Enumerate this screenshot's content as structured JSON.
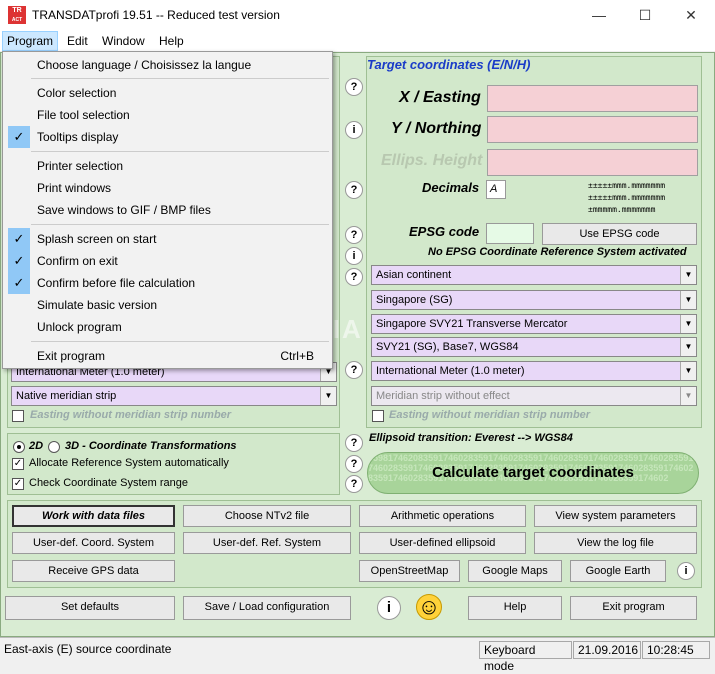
{
  "window": {
    "title": "TRANSDATprofi 19.51 -- Reduced test version",
    "logo_text": "ACT SOFT"
  },
  "window_controls": {
    "minimize": "—",
    "maximize": "☐",
    "close": "✕"
  },
  "menubar": {
    "items": [
      "Program",
      "Edit",
      "Window",
      "Help"
    ]
  },
  "program_menu": {
    "items": [
      {
        "label": "Choose language / Choisissez la langue",
        "checked": false
      },
      {
        "label": "Color selection",
        "checked": false
      },
      {
        "label": "File tool selection",
        "checked": false
      },
      {
        "label": "Tooltips display",
        "checked": true
      },
      {
        "label": "Printer selection",
        "checked": false
      },
      {
        "label": "Print windows",
        "checked": false
      },
      {
        "label": "Save windows to GIF / BMP files",
        "checked": false
      },
      {
        "label": "Splash screen on start",
        "checked": true
      },
      {
        "label": "Confirm on exit",
        "checked": true
      },
      {
        "label": "Confirm before file calculation",
        "checked": true
      },
      {
        "label": "Simulate basic version",
        "checked": false
      },
      {
        "label": "Unlock program",
        "checked": false
      },
      {
        "label": "Exit program",
        "checked": false,
        "shortcut": "Ctrl+B"
      }
    ]
  },
  "target": {
    "heading": "Target coordinates (E/N/H)",
    "easting_label": "X / Easting",
    "northing_label": "Y / Northing",
    "height_label": "Ellips. Height",
    "decimals_label": "Decimals",
    "decimals_value": "A",
    "format_lines": [
      "±±±±±mmm.mmmmmmm",
      "±±±±±mmm.mmmmmmm",
      "±mmmmm.mmmmmmm"
    ],
    "epsg_label": "EPSG code",
    "epsg_button": "Use EPSG code",
    "epsg_status": "No EPSG Coordinate Reference System activated",
    "continent": "Asian continent",
    "country": "Singapore (SG)",
    "projection": "Singapore SVY21 Transverse Mercator",
    "datum": "SVY21 (SG), Base7, WGS84",
    "unit": "International Meter (1.0 meter)",
    "meridian_strip": "Meridian strip without effect",
    "easting_without_strip": "Easting without meridian strip number",
    "ellipsoid_transition": "Ellipsoid transition: Everest --> WGS84"
  },
  "source": {
    "unit": "International Meter (1.0 meter)",
    "meridian_strip": "Native meridian strip",
    "easting_without_strip": "Easting without meridian strip number"
  },
  "options": {
    "mode_2d": "2D",
    "mode_3d": "3D - Coordinate Transformations",
    "allocate_label": "Allocate Reference System automatically",
    "check_label": "Check Coordinate System range"
  },
  "calculate_button": "Calculate target coordinates",
  "calc_digits": "3598174620835917460283591746028359174602835917460283591746028359174602835917460283591746028359174602835917460283591746028359174602835917460283591746028359174602835917460283591746028359174602",
  "buttons": {
    "row1": [
      "Work with data files",
      "Choose NTv2 file",
      "Arithmetic operations",
      "View system parameters"
    ],
    "row2": [
      "User-def. Coord. System",
      "User-def. Ref. System",
      "User-defined ellipsoid",
      "View the log file"
    ],
    "row3": [
      "Receive GPS data",
      "OpenStreetMap",
      "Google Maps",
      "Google Earth"
    ],
    "row4": [
      "Set defaults",
      "Save / Load configuration",
      "Help",
      "Exit program"
    ]
  },
  "help_glyph": "?",
  "info_glyph": "i",
  "smiley": "☺",
  "watermark": "SOFTPEDIA",
  "statusbar": {
    "hint": "East-axis (E) source coordinate",
    "mode": "Keyboard mode",
    "date": "21.09.2016",
    "time": "10:28:45"
  }
}
